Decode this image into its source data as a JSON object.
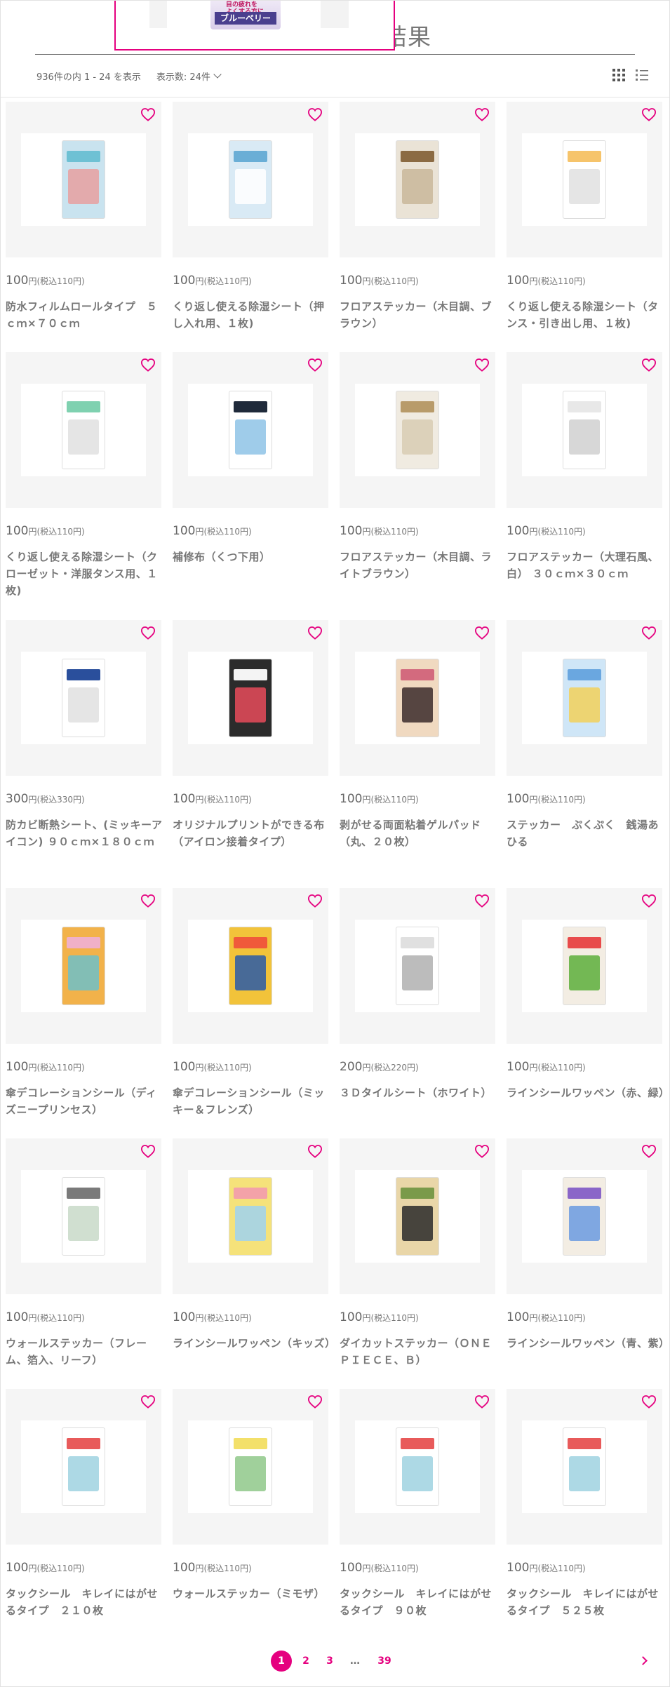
{
  "header": {
    "title_fragment": "結果",
    "popup": {
      "product_sub": "目の疲れを\nよくする方に",
      "product_name": "ブルーベリー"
    },
    "result_count": "936件の内 1 - 24 を表示",
    "per_page": "表示数: 24件",
    "view_icons": [
      "grid-view-icon",
      "list-view-icon"
    ]
  },
  "colors": {
    "accent": "#e5007f",
    "card_bg": "#f5f5f5",
    "text_muted": "#777777"
  },
  "products": [
    {
      "price": "100",
      "price_unit": "円",
      "tax": "(税込110円)",
      "name": "防水フィルムロールタイプ　５ｃｍ×７０ｃｍ"
    },
    {
      "price": "100",
      "price_unit": "円",
      "tax": "(税込110円)",
      "name": "くり返し使える除湿シート（押し入れ用、１枚)"
    },
    {
      "price": "100",
      "price_unit": "円",
      "tax": "(税込110円)",
      "name": "フロアステッカー（木目調、ブラウン）"
    },
    {
      "price": "100",
      "price_unit": "円",
      "tax": "(税込110円)",
      "name": "くり返し使える除湿シート（タンス・引き出し用、１枚)"
    },
    {
      "price": "100",
      "price_unit": "円",
      "tax": "(税込110円)",
      "name": "くり返し使える除湿シート（クローゼット・洋服タンス用、１枚)"
    },
    {
      "price": "100",
      "price_unit": "円",
      "tax": "(税込110円)",
      "name": "補修布（くつ下用）"
    },
    {
      "price": "100",
      "price_unit": "円",
      "tax": "(税込110円)",
      "name": "フロアステッカー（木目調、ライトブラウン）"
    },
    {
      "price": "100",
      "price_unit": "円",
      "tax": "(税込110円)",
      "name": "フロアステッカー（大理石風、白） ３０ｃｍ×３０ｃｍ"
    },
    {
      "price": "300",
      "price_unit": "円",
      "tax": "(税込330円)",
      "name": "防カビ断熱シート、(ミッキーアイコン) ９０ｃｍ×１８０ｃｍ"
    },
    {
      "price": "100",
      "price_unit": "円",
      "tax": "(税込110円)",
      "name": "オリジナルプリントができる布（アイロン接着タイプ）"
    },
    {
      "price": "100",
      "price_unit": "円",
      "tax": "(税込110円)",
      "name": "剥がせる両面粘着ゲルパッド（丸、２０枚）"
    },
    {
      "price": "100",
      "price_unit": "円",
      "tax": "(税込110円)",
      "name": "ステッカー　ぷくぷく　銭湯あひる"
    },
    {
      "price": "100",
      "price_unit": "円",
      "tax": "(税込110円)",
      "name": "傘デコレーションシール（ディズニープリンセス）"
    },
    {
      "price": "100",
      "price_unit": "円",
      "tax": "(税込110円)",
      "name": "傘デコレーションシール（ミッキー＆フレンズ）"
    },
    {
      "price": "200",
      "price_unit": "円",
      "tax": "(税込220円)",
      "name": "３Ｄタイルシート（ホワイト）"
    },
    {
      "price": "100",
      "price_unit": "円",
      "tax": "(税込110円)",
      "name": "ラインシールワッペン（赤、緑）"
    },
    {
      "price": "100",
      "price_unit": "円",
      "tax": "(税込110円)",
      "name": "ウォールステッカー（フレーム、箔入、リーフ）"
    },
    {
      "price": "100",
      "price_unit": "円",
      "tax": "(税込110円)",
      "name": "ラインシールワッペン（キッズ）"
    },
    {
      "price": "100",
      "price_unit": "円",
      "tax": "(税込110円)",
      "name": "ダイカットステッカー（ＯＮＥ　ＰＩＥＣＥ、Ｂ）"
    },
    {
      "price": "100",
      "price_unit": "円",
      "tax": "(税込110円)",
      "name": "ラインシールワッペン（青、紫）"
    },
    {
      "price": "100",
      "price_unit": "円",
      "tax": "(税込110円)",
      "name": "タックシール　キレイにはがせるタイプ　２１０枚"
    },
    {
      "price": "100",
      "price_unit": "円",
      "tax": "(税込110円)",
      "name": "ウォールステッカー（ミモザ）"
    },
    {
      "price": "100",
      "price_unit": "円",
      "tax": "(税込110円)",
      "name": "タックシール　キレイにはがせるタイプ　９０枚"
    },
    {
      "price": "100",
      "price_unit": "円",
      "tax": "(税込110円)",
      "name": "タックシール　キレイにはがせるタイプ　５２５枚"
    }
  ],
  "pagination": {
    "pages": [
      "1",
      "2",
      "3",
      "…",
      "39"
    ],
    "current": "1",
    "next_icon": "chevron-right-icon"
  }
}
